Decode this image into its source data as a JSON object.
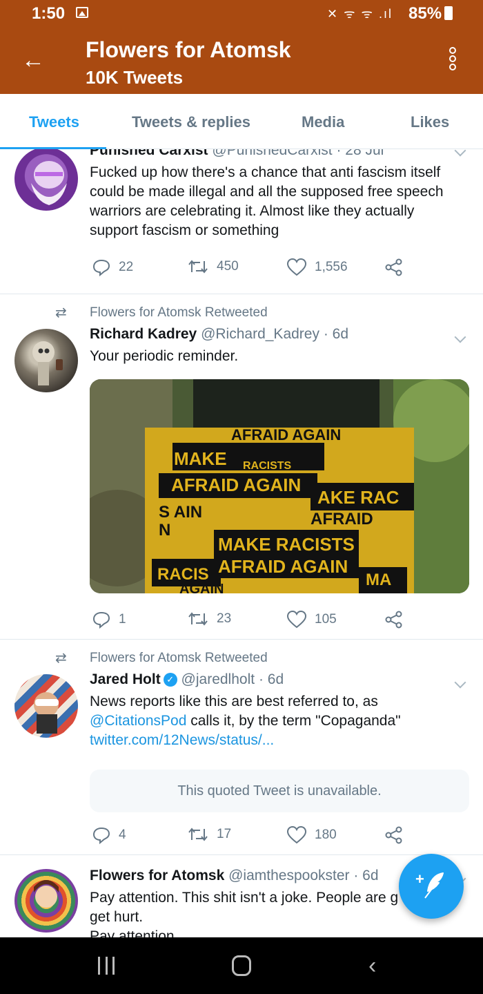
{
  "status": {
    "time": "1:50",
    "battery": "85%",
    "icons": "✕ ᯤ ᯤ .ıl"
  },
  "header": {
    "title": "Flowers for Atomsk",
    "tweets_count": "10K Tweets",
    "back_icon": "arrow-left-icon",
    "more_icon": "vertical-dots-icon"
  },
  "tabs": [
    {
      "label": "Tweets",
      "active": true
    },
    {
      "label": "Tweets & replies"
    },
    {
      "label": "Media"
    },
    {
      "label": "Likes"
    }
  ],
  "tweets": [
    {
      "name": "Punished Carxist",
      "handle": "@PunishedCarxist",
      "time": "· 28 Jul",
      "text": "Fucked up how there's a chance that anti fascism itself could be made illegal and all the supposed free speech warriors are celebrating it. Almost like they actually support fascism or something",
      "replies": "22",
      "retweets": "450",
      "likes": "1,556"
    },
    {
      "retweeted_by": "Flowers for Atomsk Retweeted",
      "name": "Richard Kadrey",
      "handle": "@Richard_Kadrey",
      "time": "· 6d",
      "text": "Your periodic reminder.",
      "image_text": {
        "top": "AFRAID AGAIN",
        "make": "MAKE",
        "racists_small": "RACISTS",
        "afraid_again": "AFRAID AGAIN",
        "s_ain": "S AIN",
        "n": "N",
        "ake_rac": "AKE RAC",
        "afraid": "AFRAID",
        "make_racists": "MAKE RACISTS",
        "afraid_again_2": "AFRAID AGAIN",
        "racis": "RACIS",
        "ma": "MA",
        "again": "AGAIN"
      },
      "replies": "1",
      "retweets": "23",
      "likes": "105"
    },
    {
      "retweeted_by": "Flowers for Atomsk Retweeted",
      "name": "Jared Holt",
      "handle": "@jaredlholt",
      "time": "· 6d",
      "text_pre": "News reports like this are best referred to, as ",
      "mention": "@CitationsPod",
      "text_post": " calls it, by the term \"Copaganda\"",
      "link": "twitter.com/12News/status/...",
      "quote": "This quoted Tweet is unavailable.",
      "replies": "4",
      "retweets": "17",
      "likes": "180"
    },
    {
      "name": "Flowers for Atomsk",
      "handle": "@iamthespookster",
      "time": "· 6d",
      "text": "Pay attention. This shit isn't a joke. People are g get hurt.",
      "text_2": "Pay attention"
    }
  ],
  "fab": {
    "label": "+",
    "icon": "compose-feather-icon"
  },
  "colors": {
    "header": "#a94a11",
    "accent": "#1da1f2",
    "muted": "#657786"
  }
}
